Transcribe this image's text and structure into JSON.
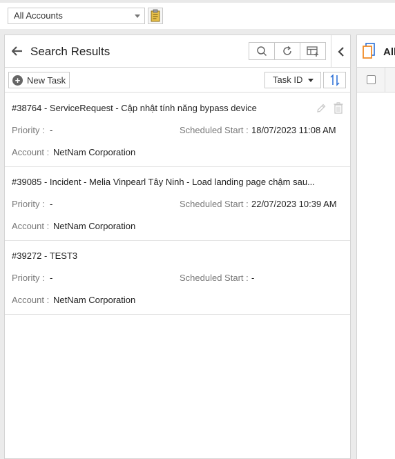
{
  "account_filter": {
    "selected": "All Accounts"
  },
  "panel": {
    "title": "Search Results",
    "new_task_label": "New Task",
    "sort_field": "Task ID"
  },
  "labels": {
    "priority": "Priority :",
    "scheduled_start": "Scheduled Start :",
    "account": "Account :"
  },
  "tasks": [
    {
      "title": "#38764 - ServiceRequest - Cập nhật tính năng bypass device",
      "priority": "-",
      "scheduled_start": "18/07/2023 11:08 AM",
      "account": "NetNam Corporation"
    },
    {
      "title": "#39085 - Incident - Melia Vinpearl Tây Ninh - Load landing page chậm sau...",
      "priority": "-",
      "scheduled_start": "22/07/2023 10:39 AM",
      "account": "NetNam Corporation"
    },
    {
      "title": "#39272 - TEST3",
      "priority": "-",
      "scheduled_start": "-",
      "account": "NetNam Corporation"
    }
  ],
  "right_panel": {
    "title": "All"
  },
  "colors": {
    "accent_orange": "#f08a24",
    "accent_blue": "#2a6fd6",
    "clipboard_yellow": "#e8c04a"
  }
}
